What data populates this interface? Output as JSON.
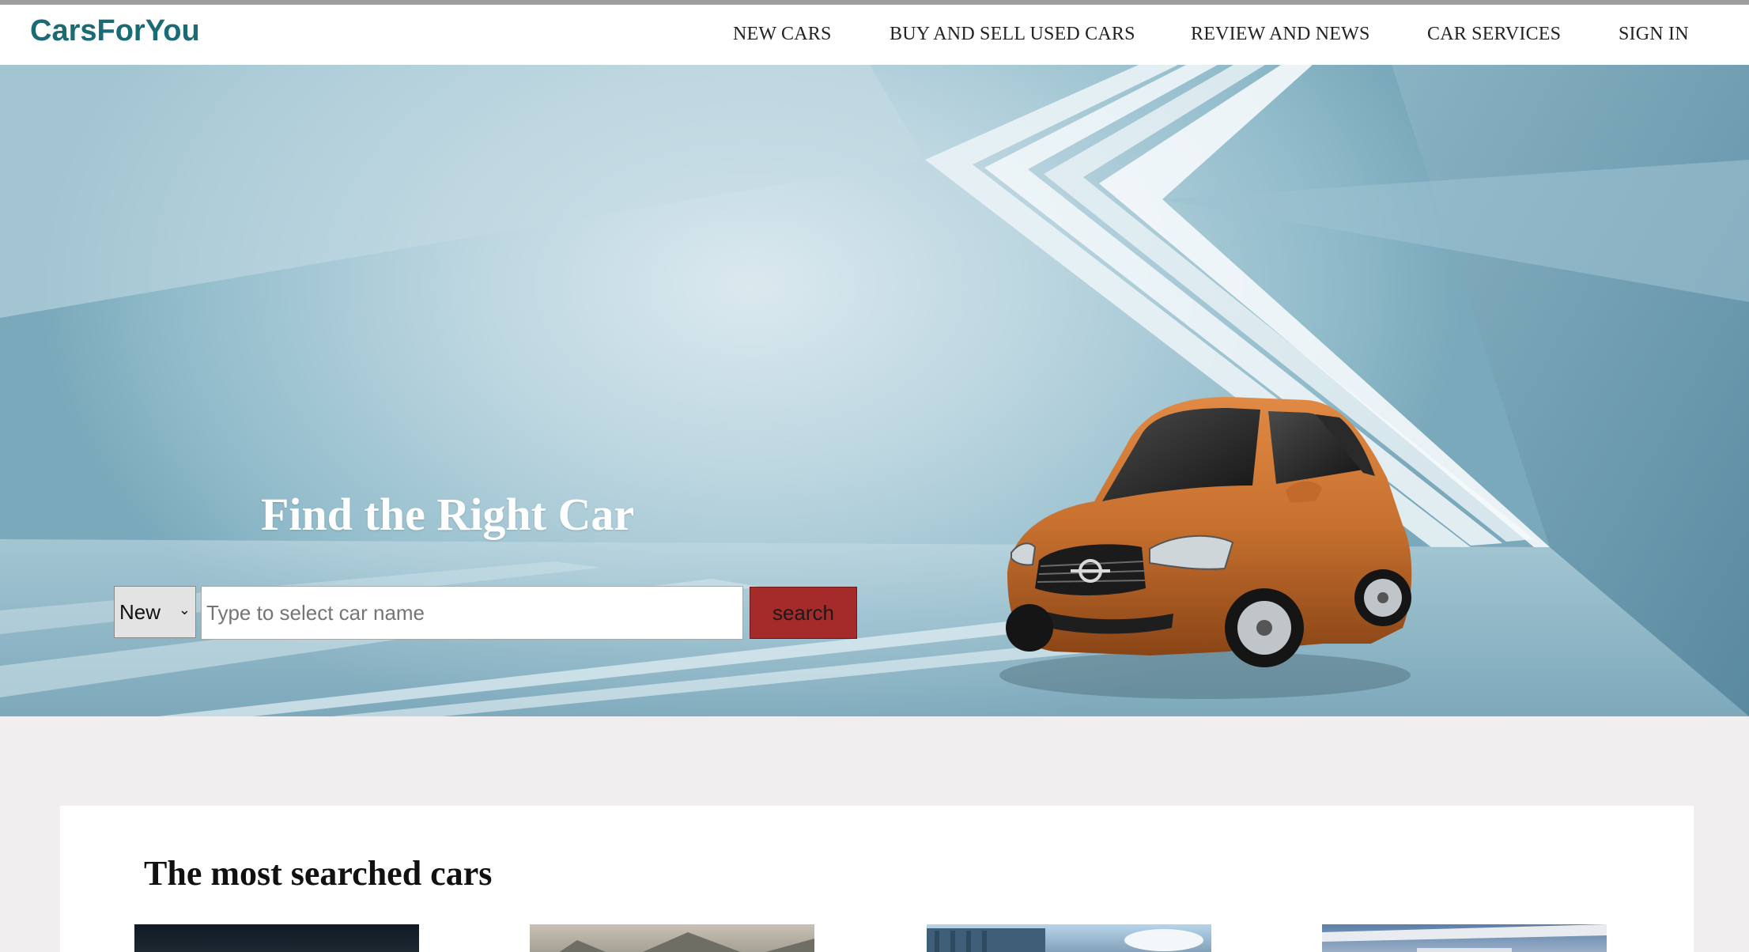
{
  "header": {
    "logo": "CarsForYou",
    "nav": [
      {
        "label": "NEW CARS"
      },
      {
        "label": "BUY AND SELL USED CARS"
      },
      {
        "label": "REVIEW AND NEWS"
      },
      {
        "label": "CAR SERVICES"
      },
      {
        "label": "SIGN IN"
      }
    ]
  },
  "hero": {
    "title": "Find the Right Car",
    "search": {
      "type_selected": "New",
      "input_value": "",
      "input_placeholder": "Type to select car name",
      "button_label": "search"
    },
    "car_image": "orange-sedan"
  },
  "most_searched": {
    "title": "The most searched cars"
  },
  "colors": {
    "brand": "#1a6b74",
    "search_button": "#a52a2a",
    "page_bg": "#f0eeef",
    "car": "#c7702f"
  }
}
